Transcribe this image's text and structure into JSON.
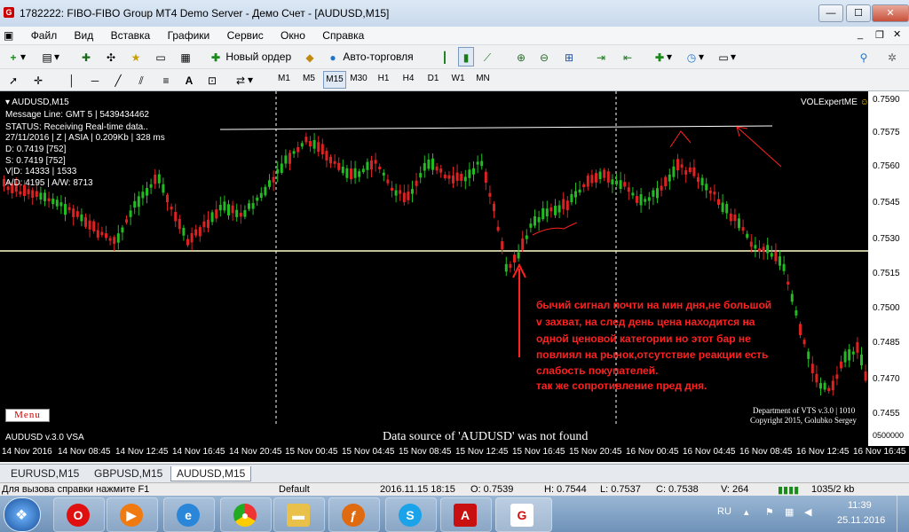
{
  "window": {
    "title": "1782222: FIBO-FIBO Group MT4 Demo Server - Демо Счет - [AUDUSD,M15]",
    "app_icon": "G"
  },
  "menu": [
    "Файл",
    "Вид",
    "Вставка",
    "Графики",
    "Сервис",
    "Окно",
    "Справка"
  ],
  "toolbar": {
    "new_order": "Новый ордер",
    "autotrading": "Авто-торговля"
  },
  "timeframes": [
    "M1",
    "M5",
    "M15",
    "M30",
    "H1",
    "H4",
    "D1",
    "W1",
    "MN"
  ],
  "timeframe_active": "M15",
  "chart": {
    "symbol_title": "AUDUSD,M15",
    "info_lines": [
      "Message Line: GMT 5 | 5439434462",
      "STATUS:  Receiving Real-time data..",
      "27/11/2016 | Z | ASIA | 0.209Kb | 328 ms",
      "D: 0.7419  [752]",
      "S: 0.7419  [752]",
      "V|D: 14333 | 1533",
      "A/D: 4195 | A/W: 8713"
    ],
    "expert": "VOLExpertME",
    "smiley": "☺",
    "menu_button": "Menu",
    "vsa_label": "AUDUSD v.3.0 VSA",
    "data_source": "Data source of 'AUDUSD' was not found",
    "credits": [
      "Department of VTS  v.3.0 | 1010",
      "Copyright 2015, Golubko Sergey"
    ],
    "annotation": [
      "бычий сигнал почти на мин дня,не большой",
      "v захват, на след день цена находится на",
      "одной ценовой категории но этот бар не",
      "повлиял на рынок,отсутствие реакции есть",
      "слабость покупателей.",
      " так же сопротивление пред дня."
    ],
    "price_labels": [
      "0.7590",
      "0.7575",
      "0.7560",
      "0.7545",
      "0.7530",
      "0.7515",
      "0.7500",
      "0.7485",
      "0.7470",
      "0.7455"
    ],
    "bottom_price": "0500000",
    "time_labels": [
      "14 Nov 2016",
      "14 Nov 08:45",
      "14 Nov 12:45",
      "14 Nov 16:45",
      "14 Nov 20:45",
      "15 Nov 00:45",
      "15 Nov 04:45",
      "15 Nov 08:45",
      "15 Nov 12:45",
      "15 Nov 16:45",
      "15 Nov 20:45",
      "16 Nov 00:45",
      "16 Nov 04:45",
      "16 Nov 08:45",
      "16 Nov 12:45",
      "16 Nov 16:45"
    ]
  },
  "tabs": [
    "EURUSD,M15",
    "GBPUSD,M15",
    "AUDUSD,M15"
  ],
  "tab_active": "AUDUSD,M15",
  "status": {
    "help": "Для вызова справки нажмите F1",
    "profile": "Default",
    "datetime": "2016.11.15 18:15",
    "open": "O: 0.7539",
    "high": "H: 0.7544",
    "low": "L: 0.7537",
    "close": "C: 0.7538",
    "volume": "V: 264",
    "traffic": "1035/2 kb"
  },
  "tray": {
    "lang": "RU",
    "time": "11:39",
    "date": "25.11.2016"
  },
  "colors": {
    "bull": "#22bb22",
    "bear": "#dd2222",
    "annotation": "#ff2020",
    "level": "#ffffcc"
  }
}
